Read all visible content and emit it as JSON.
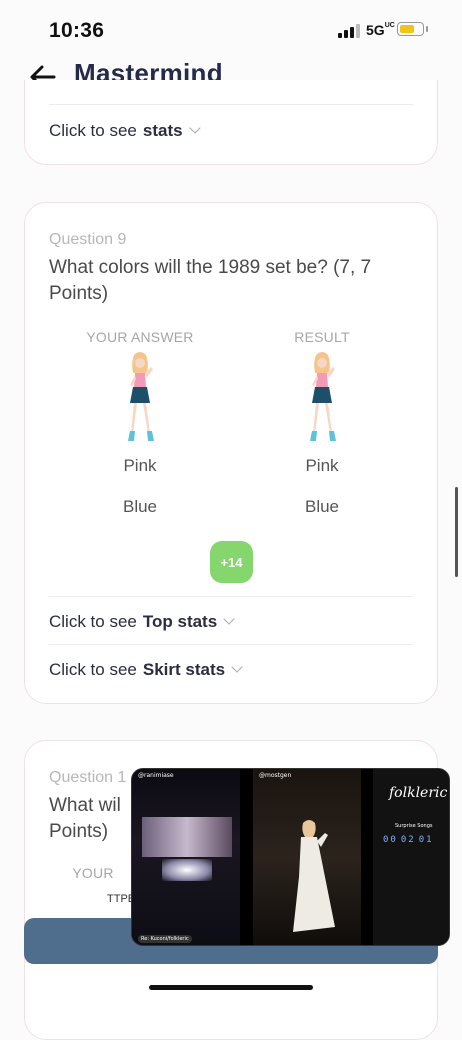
{
  "status_bar": {
    "time": "10:36",
    "network": "5G",
    "network_sup": "UC",
    "battery_level": 0.7
  },
  "header": {
    "title": "Mastermind"
  },
  "card_prev": {
    "link_prefix": "Click to see",
    "link_label": "stats"
  },
  "question9": {
    "number": "Question 9",
    "text": "What colors will the 1989 set be? (7, 7 Points)",
    "col_your_answer": "YOUR ANSWER",
    "col_result": "RESULT",
    "your_answers": [
      "Pink",
      "Blue"
    ],
    "results": [
      "Pink",
      "Blue"
    ],
    "points_badge": "+14",
    "links": [
      {
        "prefix": "Click to see",
        "label": "Top stats"
      },
      {
        "prefix": "Click to see",
        "label": "Skirt stats"
      }
    ],
    "figure": {
      "top_color": "#f29ab8",
      "skirt_color": "#1d4f6b",
      "hair_color": "#f3c48c",
      "boot_color": "#5ec3d9"
    }
  },
  "question10": {
    "number": "Question 1",
    "text": "What wil",
    "text2": "Points)",
    "col_your_answer": "YOUR",
    "answer_fragment": "TTPE"
  },
  "pip": {
    "left_handle": "@ranimiase",
    "mid_handle": "@mostgen",
    "overlay_title": "folkleric",
    "overlay_caption": "Surprise Songs",
    "counter": [
      "0",
      "0",
      "0",
      "2",
      "0",
      "1"
    ],
    "bottom_left": "Re: Kuconi/folkleric"
  },
  "colors": {
    "accent": "#252a4a",
    "badge": "#86d66e",
    "bottom_button": "#4f6d8d"
  }
}
